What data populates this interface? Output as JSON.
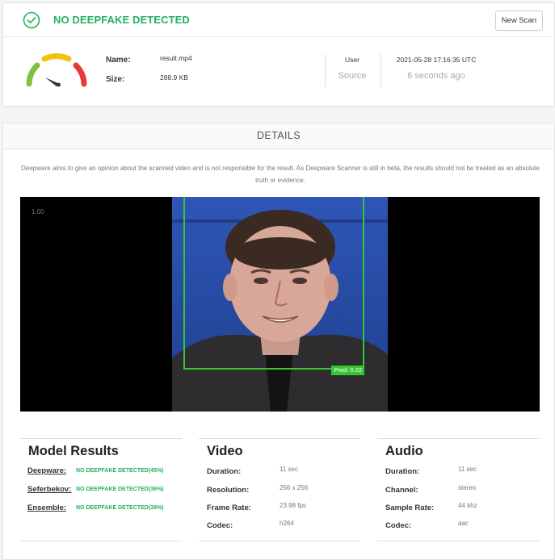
{
  "status": {
    "title": "NO DEEPFAKE DETECTED",
    "new_scan_label": "New Scan",
    "accent_color": "#25b060"
  },
  "file": {
    "name_label": "Name:",
    "name_value": "result.mp4",
    "size_label": "Size:",
    "size_value": "288.9 KB"
  },
  "source": {
    "user_label": "User",
    "source_label": "Source",
    "timestamp": "2021-05-28 17:16:35 UTC",
    "relative_time": "6 seconds ago"
  },
  "details": {
    "title": "DETAILS",
    "disclaimer": "Deepware aims to give an opinion about the scanned video and is not responsible for the result. As Deepware Scanner is still in beta, the results should not be treated as an absolute truth or evidence."
  },
  "video": {
    "timestamp": "1.00",
    "pred_label": "Pred: 0.02"
  },
  "model_results": {
    "title": "Model Results",
    "items": [
      {
        "name": "Deepware:",
        "result": "NO DEEPFAKE DETECTED(45%)"
      },
      {
        "name": "Seferbekov:",
        "result": "NO DEEPFAKE DETECTED(36%)"
      },
      {
        "name": "Ensemble:",
        "result": "NO DEEPFAKE DETECTED(38%)"
      }
    ]
  },
  "video_info": {
    "title": "Video",
    "rows": [
      {
        "label": "Duration:",
        "value": "11 sec"
      },
      {
        "label": "Resolution:",
        "value": "256 x 256"
      },
      {
        "label": "Frame Rate:",
        "value": "23.98 fps"
      },
      {
        "label": "Codec:",
        "value": "h264"
      }
    ]
  },
  "audio_info": {
    "title": "Audio",
    "rows": [
      {
        "label": "Duration:",
        "value": "11 sec"
      },
      {
        "label": "Channel:",
        "value": "stereo"
      },
      {
        "label": "Sample Rate:",
        "value": "44 khz"
      },
      {
        "label": "Codec:",
        "value": "aac"
      }
    ]
  },
  "gauge": {
    "colors": [
      "#e53935",
      "#f4c20d",
      "#7cc243"
    ]
  }
}
